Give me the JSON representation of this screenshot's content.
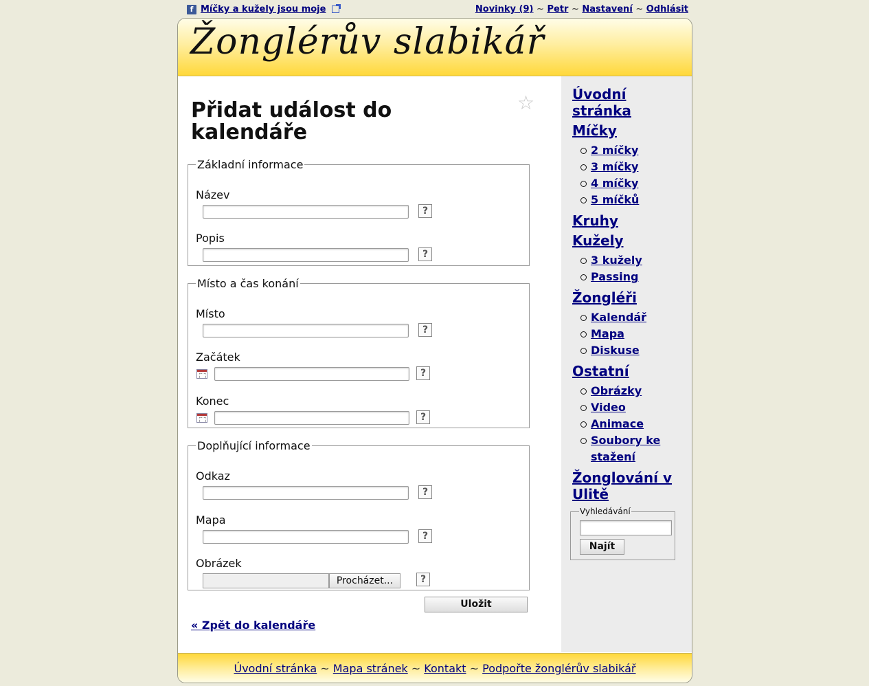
{
  "topbar": {
    "fb_icon": "facebook-icon",
    "fb_link": "Míčky a kužely jsou moje",
    "links": {
      "news": "Novinky (9)",
      "user": "Petr",
      "settings": "Nastavení",
      "logout": "Odhlásit"
    },
    "separator": "~"
  },
  "header": {
    "logo": "Žonglérův slabikář"
  },
  "page": {
    "title": "Přidat událost do kalendáře",
    "favorite_icon": "star-icon"
  },
  "form": {
    "basic": {
      "legend": "Základní informace",
      "name_label": "Název",
      "description_label": "Popis"
    },
    "place_time": {
      "legend": "Místo a čas konání",
      "place_label": "Místo",
      "start_label": "Začátek",
      "end_label": "Konec"
    },
    "extra": {
      "legend": "Doplňující informace",
      "link_label": "Odkaz",
      "map_label": "Mapa",
      "image_label": "Obrázek",
      "browse_label": "Procházet..."
    },
    "help": "?",
    "save": "Uložit",
    "back": "« Zpět do kalendáře"
  },
  "sidebar": {
    "home": "Úvodní stránka",
    "balls": "Míčky",
    "balls_items": [
      "2 míčky",
      "3 míčky",
      "4 míčky",
      "5 míčků"
    ],
    "rings": "Kruhy",
    "clubs": "Kužely",
    "clubs_items": [
      "3 kužely",
      "Passing"
    ],
    "jugglers": "Žongléři",
    "jugglers_items": [
      "Kalendář",
      "Mapa",
      "Diskuse"
    ],
    "other": "Ostatní",
    "other_items": [
      "Obrázky",
      "Video",
      "Animace",
      "Soubory ke stažení"
    ],
    "street": "Žonglování v Ulitě",
    "search": {
      "legend": "Vyhledávání",
      "button": "Najít"
    }
  },
  "footer": {
    "home": "Úvodní stránka",
    "sitemap": "Mapa stránek",
    "contact": "Kontakt",
    "support": "Podpořte žonglérův slabikář",
    "separator": "~"
  },
  "colors": {
    "link": "#00007f",
    "header_yellow": "#ffd83a",
    "background": "#ecebdc",
    "sidebar": "#ececec"
  }
}
